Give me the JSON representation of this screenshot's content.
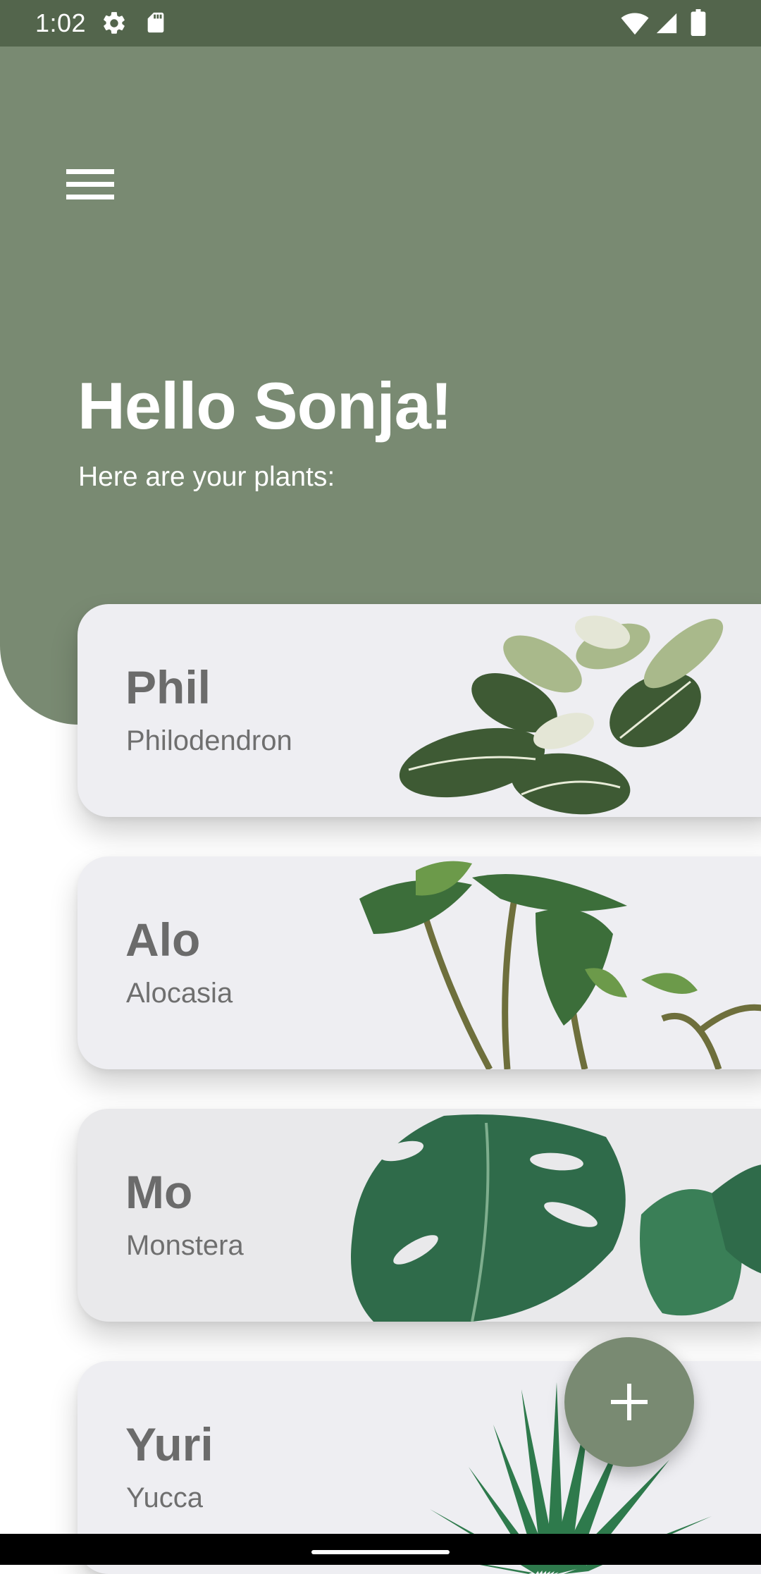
{
  "status_bar": {
    "time": "1:02",
    "icons": [
      "settings-gear-icon",
      "sd-card-icon",
      "wifi-icon",
      "cell-signal-icon",
      "battery-icon"
    ]
  },
  "header": {
    "greeting": "Hello Sonja!",
    "subtitle": "Here are your plants:",
    "menu_icon": "hamburger-menu-icon"
  },
  "plants": [
    {
      "name": "Phil",
      "species": "Philodendron"
    },
    {
      "name": "Alo",
      "species": "Alocasia"
    },
    {
      "name": "Mo",
      "species": "Monstera"
    },
    {
      "name": "Yuri",
      "species": "Yucca"
    }
  ],
  "fab": {
    "icon": "plus-icon"
  },
  "colors": {
    "header_green": "#798a72",
    "status_green": "#53654c",
    "card_bg": "#eeeef2",
    "text_grey": "#6b6b6b"
  }
}
